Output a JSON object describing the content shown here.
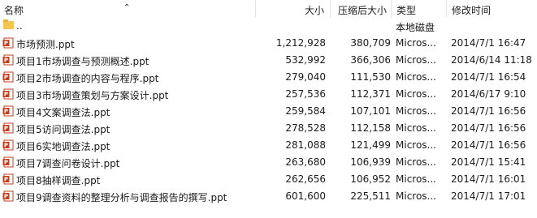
{
  "header": {
    "name": "名称",
    "size": "大小",
    "compressed": "压缩后大小",
    "type": "类型",
    "modified": "修改时间"
  },
  "parent": {
    "name": "..",
    "type": "本地磁盘"
  },
  "files": [
    {
      "name": "市场预测.ppt",
      "size": "1,212,928",
      "compressed": "380,709",
      "type": "Micros...",
      "modified": "2014/7/1 16:47"
    },
    {
      "name": "项目1市场调查与预测概述.ppt",
      "size": "532,992",
      "compressed": "366,306",
      "type": "Micros...",
      "modified": "2014/6/14 11:18"
    },
    {
      "name": "项目2市场调查的内容与程序.ppt",
      "size": "279,040",
      "compressed": "111,530",
      "type": "Micros...",
      "modified": "2014/7/1 16:54"
    },
    {
      "name": "项目3市场调查策划与方案设计.ppt",
      "size": "257,536",
      "compressed": "112,371",
      "type": "Micros...",
      "modified": "2014/6/17 9:10"
    },
    {
      "name": "项目4文案调查法.ppt",
      "size": "259,584",
      "compressed": "107,101",
      "type": "Micros...",
      "modified": "2014/7/1 16:56"
    },
    {
      "name": "项目5访问调查法.ppt",
      "size": "278,528",
      "compressed": "112,158",
      "type": "Micros...",
      "modified": "2014/7/1 16:56"
    },
    {
      "name": "项目6实地调查法.ppt",
      "size": "281,088",
      "compressed": "121,499",
      "type": "Micros...",
      "modified": "2014/7/1 16:56"
    },
    {
      "name": "项目7调查问卷设计.ppt",
      "size": "263,680",
      "compressed": "106,939",
      "type": "Micros...",
      "modified": "2014/7/1 15:41"
    },
    {
      "name": "项目8抽样调查.ppt",
      "size": "262,656",
      "compressed": "106,952",
      "type": "Micros...",
      "modified": "2014/7/1 16:01"
    },
    {
      "name": "项目9调查资料的整理分析与调查报告的撰写.ppt",
      "size": "601,600",
      "compressed": "225,511",
      "type": "Micros...",
      "modified": "2014/7/1 17:01"
    }
  ],
  "colors": {
    "ppt_icon": "#c43e1c",
    "folder": "#f5c451"
  }
}
